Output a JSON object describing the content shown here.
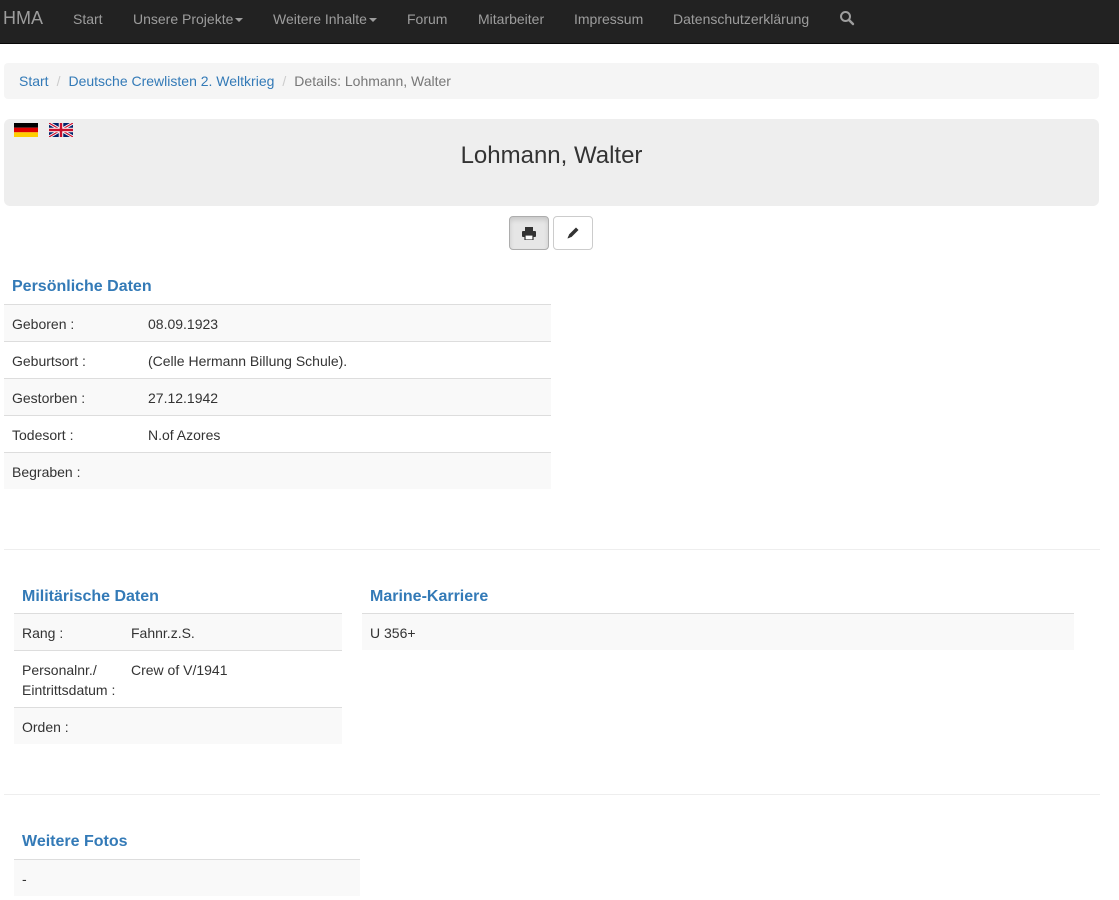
{
  "navbar": {
    "brand": "HMA",
    "items": [
      "Start",
      "Unsere Projekte",
      "Weitere Inhalte",
      "Forum",
      "Mitarbeiter",
      "Impressum",
      "Datenschutzerklärung"
    ]
  },
  "breadcrumb": {
    "items": [
      "Start",
      "Deutsche Crewlisten 2. Weltkrieg"
    ],
    "current": "Details: Lohmann, Walter"
  },
  "header": {
    "name": "Lohmann, Walter",
    "flags": [
      "de-flag",
      "gb-flag"
    ]
  },
  "personal": {
    "title": "Persönliche Daten",
    "rows": [
      {
        "label": "Geboren :",
        "value": "08.09.1923"
      },
      {
        "label": "Geburtsort :",
        "value": "(Celle Hermann Billung Schule)."
      },
      {
        "label": "Gestorben :",
        "value": "27.12.1942"
      },
      {
        "label": "Todesort :",
        "value": "N.of Azores"
      },
      {
        "label": "Begraben :",
        "value": ""
      }
    ]
  },
  "military": {
    "title": "Militärische Daten",
    "rows": [
      {
        "label": "Rang :",
        "value": "Fahnr.z.S."
      },
      {
        "label_line1": "Personalnr./",
        "label_line2": "Eintrittsdatum :",
        "value": "Crew of V/1941"
      },
      {
        "label": "Orden :",
        "value": ""
      }
    ]
  },
  "career": {
    "title": "Marine-Karriere",
    "rows": [
      "U 356+"
    ]
  },
  "photos": {
    "title": "Weitere Fotos",
    "rows": [
      "-"
    ]
  },
  "colors": {
    "navbar_bg": "#222222",
    "link": "#337ab7",
    "section_title": "#337ab7",
    "stripe": "#f9f9f9"
  }
}
